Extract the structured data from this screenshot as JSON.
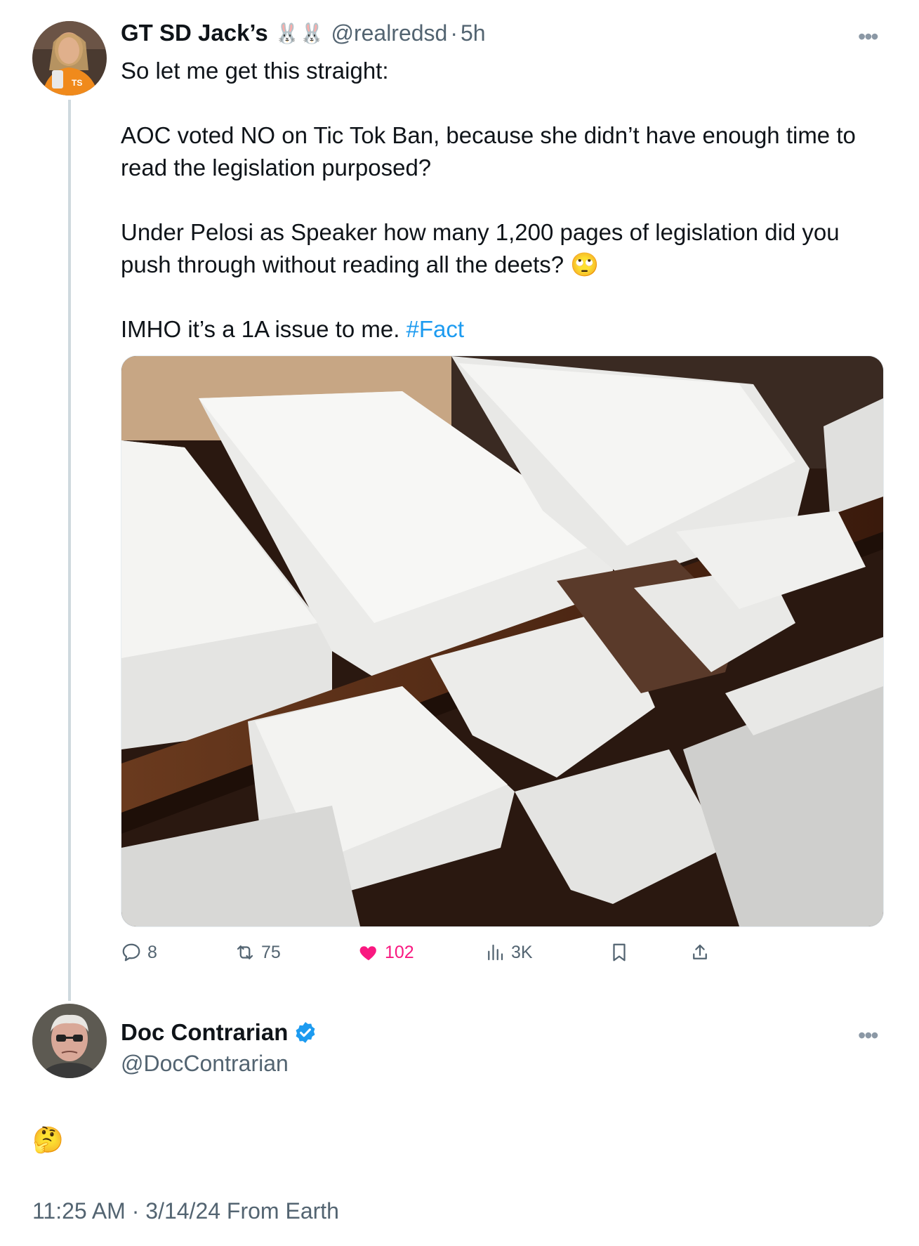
{
  "tweet": {
    "author_name": "GT SD Jack’s",
    "author_emojis": "🐰🐰",
    "handle": "@realredsd",
    "separator": "·",
    "time_ago": "5h",
    "lines": {
      "l1": "So let me get this straight:",
      "l2": "AOC voted NO on Tic Tok Ban, because she didn’t have enough time to read the legislation purposed?",
      "l3": "Under Pelosi as Speaker how many 1,200 pages of legislation did you push through without reading all the deets? 🙄",
      "l4": "IMHO it’s a 1A issue to me. ",
      "hashtag": "#Fact"
    },
    "image_alt": "stacks of thick printed legislation documents on wooden shelves",
    "actions": {
      "replies": "8",
      "reposts": "75",
      "likes": "102",
      "views": "3K"
    },
    "colors": {
      "like": "#f91880",
      "link": "#1d9bf0",
      "muted": "#536471"
    }
  },
  "reply": {
    "author_name": "Doc Contrarian",
    "handle": "@DocContrarian",
    "verified": true,
    "text": "🤔",
    "timestamp": "11:25 AM · 3/14/24 From Earth"
  },
  "icons": [
    "more-icon",
    "reply-icon",
    "repost-icon",
    "like-icon",
    "views-icon",
    "bookmark-icon",
    "share-icon",
    "verified-badge-icon"
  ]
}
